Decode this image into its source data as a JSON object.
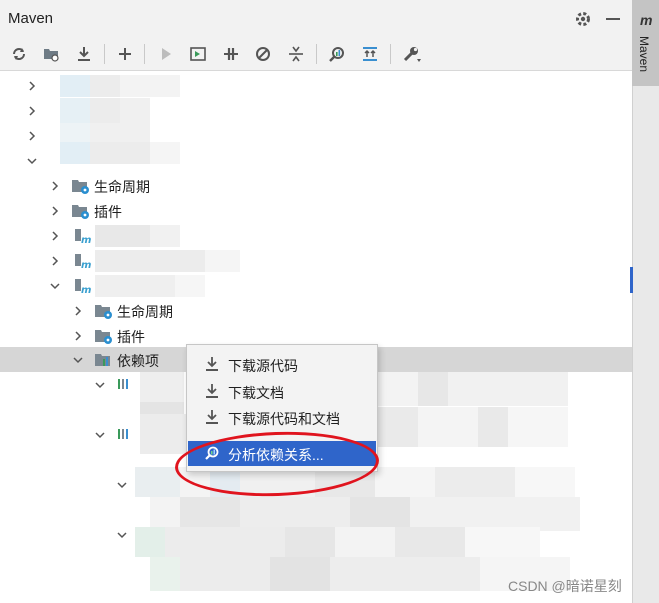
{
  "window": {
    "title": "Maven"
  },
  "side_tab": {
    "glyph": "m",
    "label": "Maven"
  },
  "toolbar": {
    "icons": [
      "reload-icon",
      "add-folder-icon",
      "download-icon",
      "add-icon",
      "run-icon",
      "execute-goal-icon",
      "toggle-offline-icon",
      "skip-tests-icon",
      "collapse-all-icon",
      "analyze-dependencies-icon",
      "show-dependencies-icon",
      "settings-wrench-icon"
    ]
  },
  "tree": {
    "lifecycle_1": "生命周期",
    "plugins_1": "插件",
    "lifecycle_2": "生命周期",
    "plugins_2": "插件",
    "dependencies": "依赖项"
  },
  "context_menu": {
    "items": [
      {
        "label": "下载源代码",
        "icon": "download-icon"
      },
      {
        "label": "下载文档",
        "icon": "download-icon"
      },
      {
        "label": "下载源代码和文档",
        "icon": "download-icon"
      },
      {
        "label": "分析依赖关系...",
        "icon": "analyze-dependencies-icon"
      }
    ],
    "selected_index": 3
  },
  "annotation": {
    "color": "#e0141e"
  },
  "watermark": "CSDN @暗诺星刻",
  "colors": {
    "selection": "#2f65ca",
    "folder": "#7a8791",
    "maven_badge": "#3aa0d0",
    "gear_badge": "#2a8fd0"
  }
}
